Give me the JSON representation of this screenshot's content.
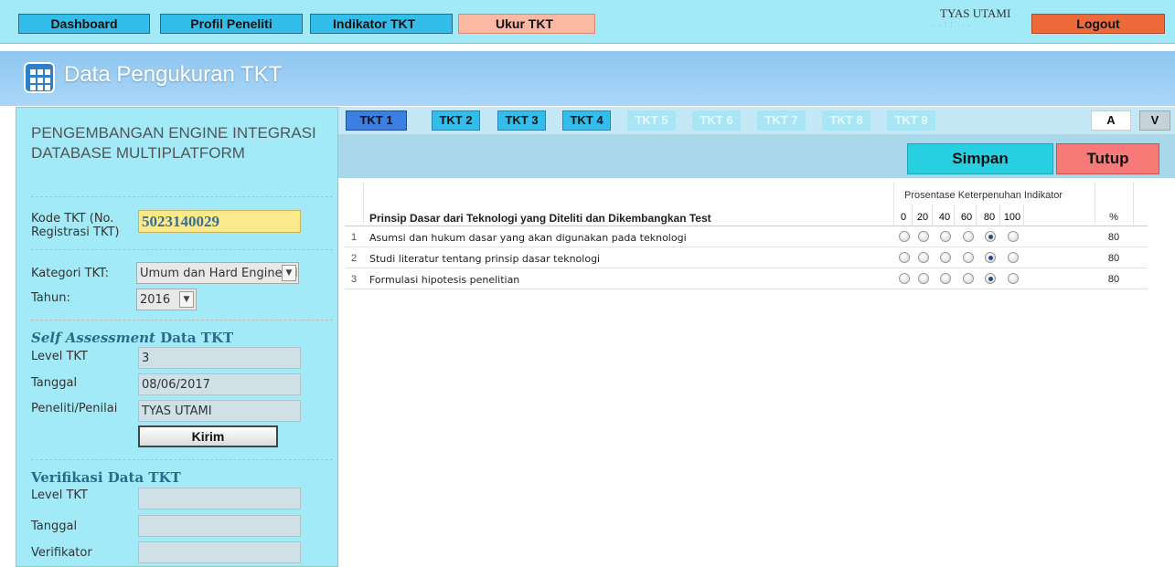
{
  "nav": {
    "dashboard": "Dashboard",
    "profil": "Profil Peneliti",
    "indikator": "Indikator TKT",
    "ukur": "Ukur TKT",
    "logout": "Logout",
    "username": "TYAS UTAMI"
  },
  "header": {
    "title": "Data Pengukuran TKT"
  },
  "left": {
    "project_title": "PENGEMBANGAN ENGINE INTEGRASI DATABASE MULTIPLATFORM",
    "kode_label": "Kode TKT (No. Registrasi TKT)",
    "kode_value": "5023140029",
    "kategori_label": "Kategori TKT:",
    "kategori_value": "Umum dan Hard Engineering",
    "tahun_label": "Tahun:",
    "tahun_value": "2016",
    "self_heading_italic": "Self Assessment",
    "self_heading_rest": " Data TKT",
    "self_level_label": "Level TKT",
    "self_level_value": "3",
    "self_tanggal_label": "Tanggal",
    "self_tanggal_value": "08/06/2017",
    "self_penilai_label": "Peneliti/Penilai",
    "self_penilai_value": "TYAS UTAMI",
    "kirim": "Kirim",
    "verif_heading": "Verifikasi Data TKT",
    "verif_level_label": "Level TKT",
    "verif_tanggal_label": "Tanggal",
    "verif_verifikator_label": "Verifikator"
  },
  "tabs": [
    "TKT 1",
    "TKT 2",
    "TKT 3",
    "TKT 4",
    "TKT 5",
    "TKT 6",
    "TKT 7",
    "TKT 8",
    "TKT 9"
  ],
  "view_buttons": {
    "a": "A",
    "v": "V"
  },
  "actions": {
    "simpan": "Simpan",
    "tutup": "Tutup"
  },
  "table": {
    "group_header": "Prosentase Keterpenuhan Indikator",
    "title": "Prinsip Dasar dari Teknologi yang Diteliti dan Dikembangkan Test",
    "columns": [
      "0",
      "20",
      "40",
      "60",
      "80",
      "100"
    ],
    "pct_header": "%",
    "rows": [
      {
        "num": "1",
        "text": "Asumsi dan hukum dasar yang akan digunakan pada teknologi",
        "selected": "80",
        "pct": "80"
      },
      {
        "num": "2",
        "text": "Studi literatur tentang prinsip dasar teknologi",
        "selected": "80",
        "pct": "80"
      },
      {
        "num": "3",
        "text": "Formulasi hipotesis penelitian",
        "selected": "80",
        "pct": "80"
      }
    ]
  }
}
